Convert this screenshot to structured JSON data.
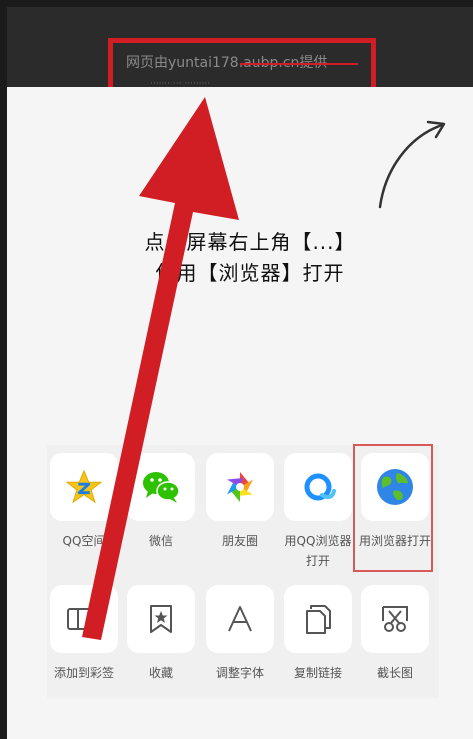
{
  "header": {
    "provider_text": "网页由yuntai178.aubp.cn提供",
    "subtext": "·······  ···  ·········"
  },
  "hint": {
    "line1": "点击屏幕右上角【...】",
    "line2": "使用【浏览器】打开"
  },
  "share_row1": [
    {
      "label": "QQ空间",
      "icon": "qzone-star-icon"
    },
    {
      "label": "微信",
      "icon": "wechat-icon"
    },
    {
      "label": "朋友圈",
      "icon": "moments-aperture-icon"
    },
    {
      "label": "用QQ浏览器打开",
      "icon": "qq-browser-icon"
    },
    {
      "label": "用浏览器打开",
      "icon": "globe-icon"
    }
  ],
  "share_row2": [
    {
      "label": "添加到彩签",
      "icon": "window-tag-icon"
    },
    {
      "label": "收藏",
      "icon": "bookmark-star-icon"
    },
    {
      "label": "调整字体",
      "icon": "font-a-icon"
    },
    {
      "label": "复制链接",
      "icon": "copy-icon"
    },
    {
      "label": "截长图",
      "icon": "screenshot-scissors-icon"
    }
  ],
  "colors": {
    "annotation_red": "#d01e24",
    "highlight_border": "#d65a5a",
    "wechat_green": "#2dc100",
    "qzone_yellow": "#f7c51a"
  }
}
